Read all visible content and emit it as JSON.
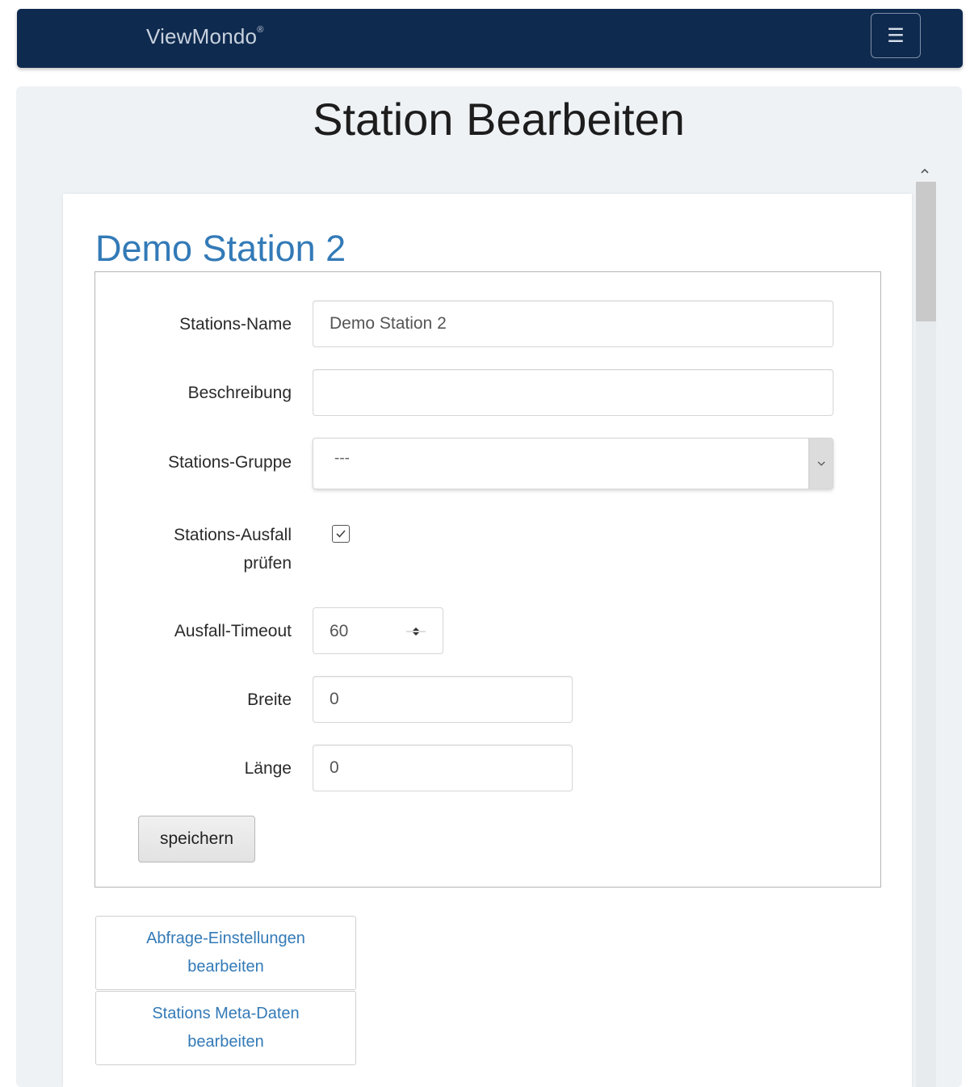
{
  "navbar": {
    "brand": "ViewMondo",
    "brand_mark": "®",
    "menu_icon": "hamburger-icon",
    "menu_glyph": "☰"
  },
  "page": {
    "title": "Station Bearbeiten"
  },
  "station": {
    "heading": "Demo Station 2"
  },
  "form": {
    "name_label": "Stations-Name",
    "name_value": "Demo Station 2",
    "description_label": "Beschreibung",
    "description_value": "",
    "group_label": "Stations-Gruppe",
    "group_selected": "---",
    "failure_check_label_line1": "Stations-Ausfall",
    "failure_check_label_line2": "prüfen",
    "failure_check_checked": true,
    "timeout_label": "Ausfall-Timeout",
    "timeout_value": "60",
    "latitude_label": "Breite",
    "latitude_value": "0",
    "longitude_label": "Länge",
    "longitude_value": "0",
    "save_label": "speichern"
  },
  "links": [
    {
      "line1": "Abfrage-Einstellungen",
      "line2": "bearbeiten"
    },
    {
      "line1": "Stations Meta-Daten",
      "line2": "bearbeiten"
    }
  ],
  "colors": {
    "navbar": "#0f2a4f",
    "accent": "#337ab7"
  }
}
